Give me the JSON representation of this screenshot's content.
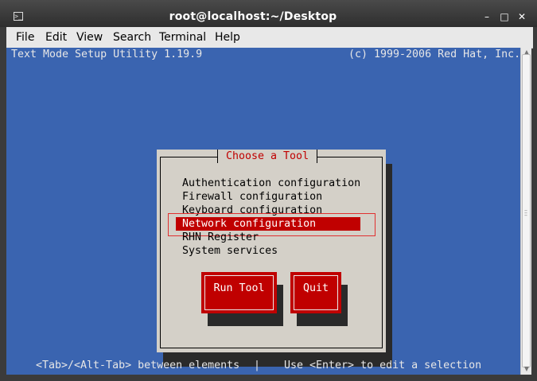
{
  "window": {
    "title": "root@localhost:~/Desktop",
    "controls": {
      "minimize": "–",
      "maximize": "□",
      "close": "✕"
    }
  },
  "menubar": {
    "items": [
      "File",
      "Edit",
      "View",
      "Search",
      "Terminal",
      "Help"
    ]
  },
  "terminal": {
    "header_left": "Text Mode Setup Utility 1.19.9",
    "header_right": "(c) 1999-2006 Red Hat, Inc.",
    "footer_left": "<Tab>/<Alt-Tab> between elements",
    "footer_sep": "|",
    "footer_right": "Use <Enter> to edit a selection"
  },
  "dialog": {
    "title": "Choose a Tool",
    "items": [
      "Authentication configuration",
      "Firewall configuration",
      "Keyboard configuration",
      "Network configuration",
      "RHN Register",
      "System services"
    ],
    "selected_index": 3,
    "buttons": {
      "run": "Run Tool",
      "quit": "Quit"
    }
  },
  "colors": {
    "terminal_bg": "#3a64b0",
    "dialog_bg": "#d4d0c8",
    "accent": "#c00000"
  }
}
